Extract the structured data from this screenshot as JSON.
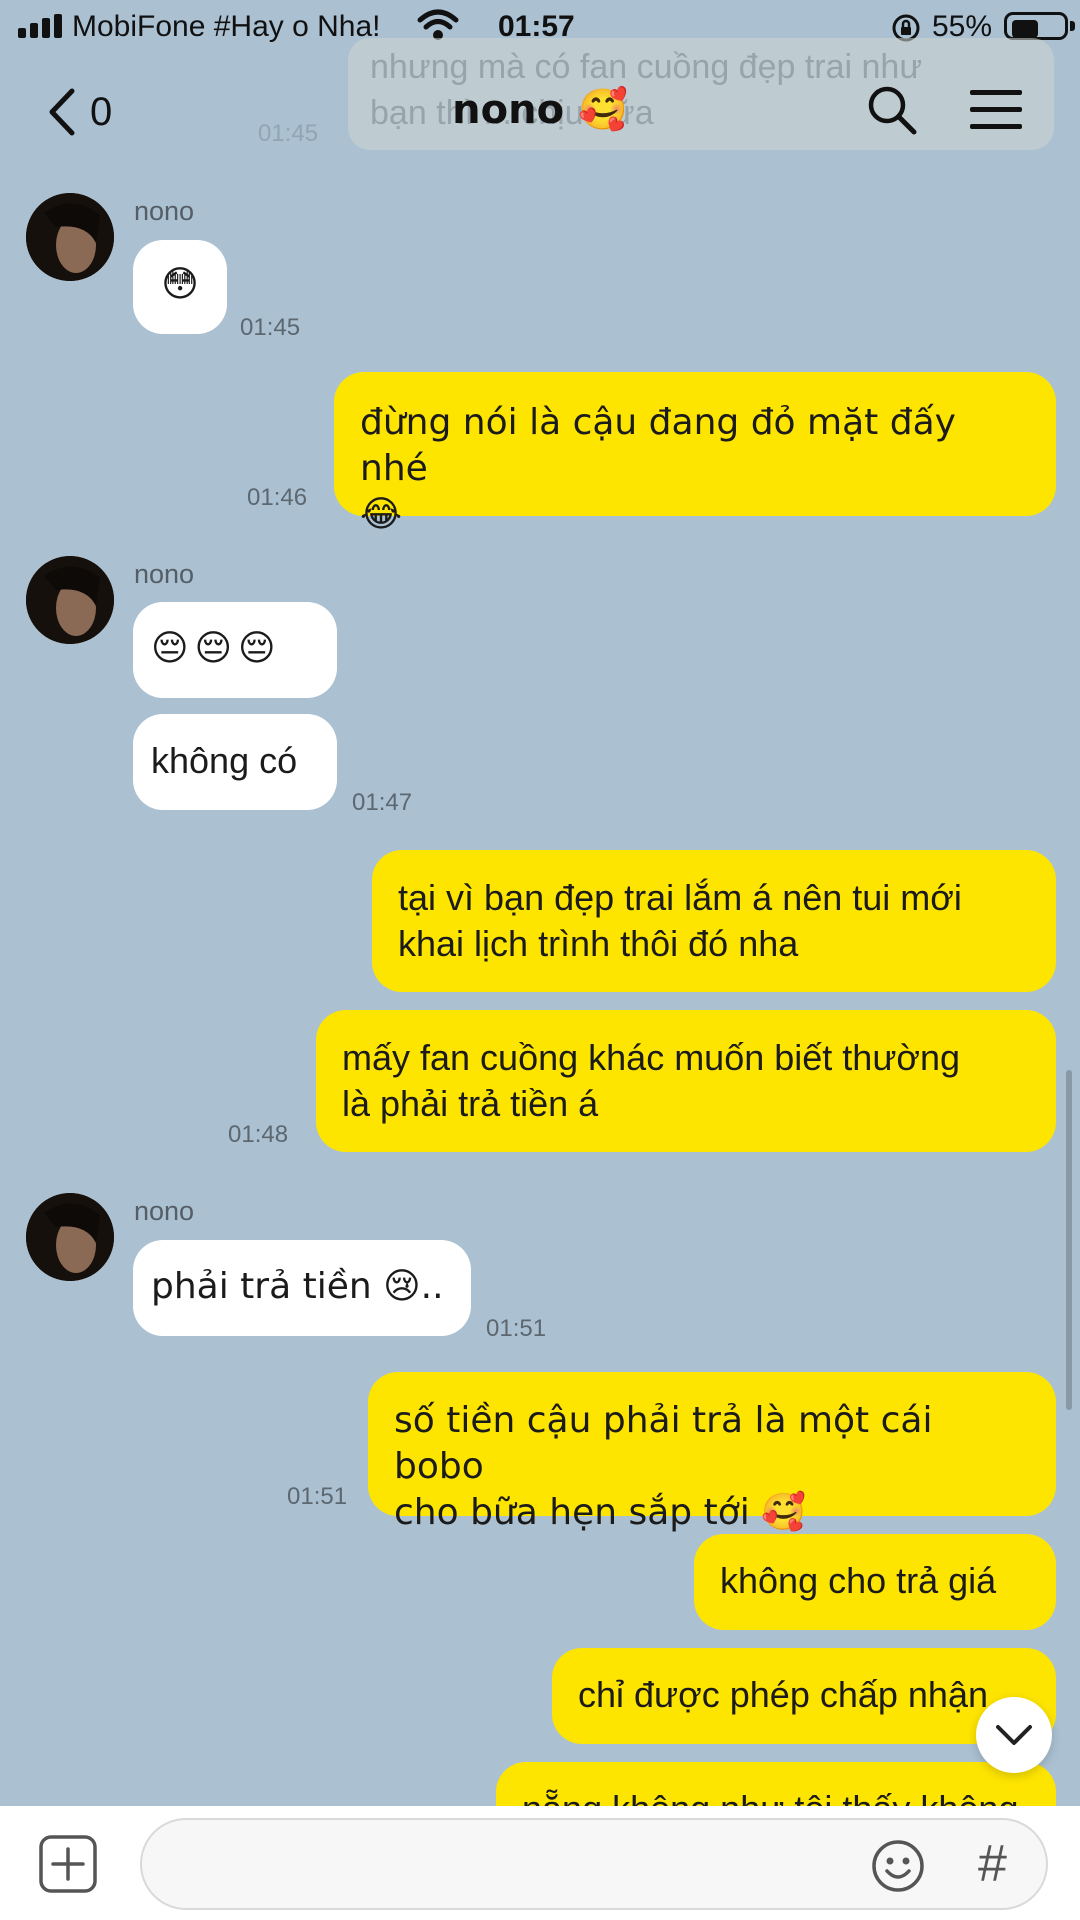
{
  "status_bar": {
    "carrier": "MobiFone #Hay o Nha!",
    "time": "01:57",
    "battery_percent": "55%",
    "battery_level": 0.55
  },
  "header": {
    "back_count": "0",
    "title": "nono 🥰"
  },
  "ghost_preview": {
    "text": "nhưng mà có fan cuồng đẹp trai như\nbạn thì ... chịu nữa",
    "time": "01:45"
  },
  "messages": [
    {
      "side": "in",
      "sender": "nono",
      "text": "😳",
      "time": "01:45"
    },
    {
      "side": "out",
      "text": "đừng nói là cậu đang đỏ mặt đấy nhé\n😂",
      "time": "01:46"
    },
    {
      "side": "in",
      "sender": "nono",
      "text": "😔😔😔",
      "time": ""
    },
    {
      "side": "in",
      "text": "không có",
      "time": "01:47"
    },
    {
      "side": "out",
      "text": "tại vì bạn đẹp trai lắm á nên tui mới\nkhai lịch trình thôi đó nha",
      "time": ""
    },
    {
      "side": "out",
      "text": "mấy fan cuồng khác muốn biết thường\nlà phải trả tiền á",
      "time": "01:48"
    },
    {
      "side": "in",
      "sender": "nono",
      "text": "phải trả tiền 😢..",
      "time": "01:51"
    },
    {
      "side": "out",
      "text": "số tiền cậu phải trả là một cái bobo\ncho bữa hẹn sắp tới 🥰",
      "time": "01:51"
    },
    {
      "side": "out",
      "text": "không cho trả giá",
      "time": ""
    },
    {
      "side": "out",
      "text": "chỉ được phép chấp nhận",
      "time": ""
    },
    {
      "side": "out",
      "text": "nẵng không như tôi thấy không",
      "time": ""
    }
  ],
  "input": {
    "placeholder": "",
    "add_icon": "plus-square-icon",
    "emoji_icon": "smiley-icon",
    "hashtag_label": "#"
  },
  "colors": {
    "background": "#abc1d2",
    "outgoing_bubble": "#fee500",
    "incoming_bubble": "#ffffff"
  }
}
